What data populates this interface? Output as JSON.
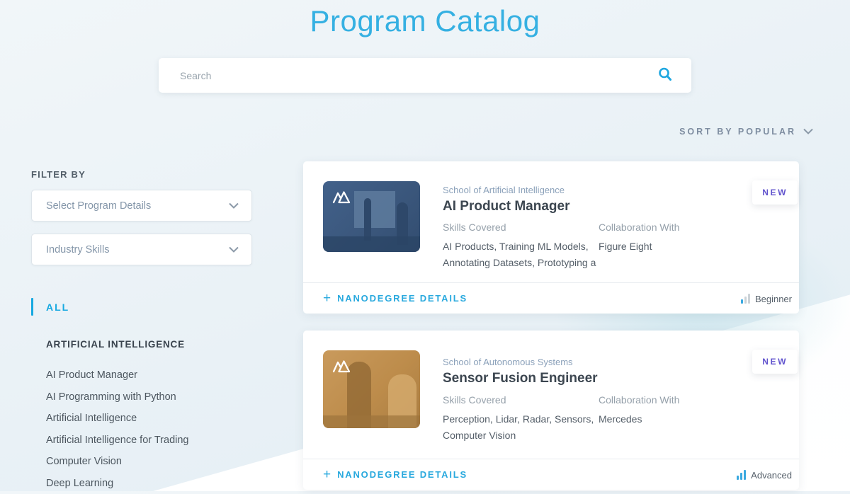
{
  "page": {
    "title": "Program Catalog"
  },
  "search": {
    "placeholder": "Search"
  },
  "sort": {
    "label": "SORT BY POPULAR"
  },
  "filters": {
    "heading": "FILTER BY",
    "program_details_dropdown": "Select Program Details",
    "industry_skills_dropdown": "Industry Skills"
  },
  "nav": {
    "all": "ALL",
    "category": "ARTIFICIAL INTELLIGENCE",
    "items": [
      "AI Product Manager",
      "AI Programming with Python",
      "Artificial Intelligence",
      "Artificial Intelligence for Trading",
      "Computer Vision",
      "Deep Learning"
    ]
  },
  "cards": [
    {
      "school": "School of Artificial Intelligence",
      "title": "AI Product Manager",
      "skills_label": "Skills Covered",
      "skills": "AI Products, Training ML Models, Annotating Datasets, Prototyping a",
      "collaboration_label": "Collaboration With",
      "collaboration": "Figure Eight",
      "badge": "NEW",
      "details_label": "NANODEGREE DETAILS",
      "level": "Beginner"
    },
    {
      "school": "School of Autonomous Systems",
      "title": "Sensor Fusion Engineer",
      "skills_label": "Skills Covered",
      "skills": "Perception, Lidar, Radar, Sensors, Computer Vision",
      "collaboration_label": "Collaboration With",
      "collaboration": "Mercedes",
      "badge": "NEW",
      "details_label": "NANODEGREE DETAILS",
      "level": "Advanced"
    }
  ],
  "colors": {
    "title_blue": "#35b0e2",
    "accent_blue": "#29a9de",
    "badge_purple": "#6254ce",
    "thumb_card1": "#3a567b",
    "thumb_card2": "#bd8c4b"
  }
}
